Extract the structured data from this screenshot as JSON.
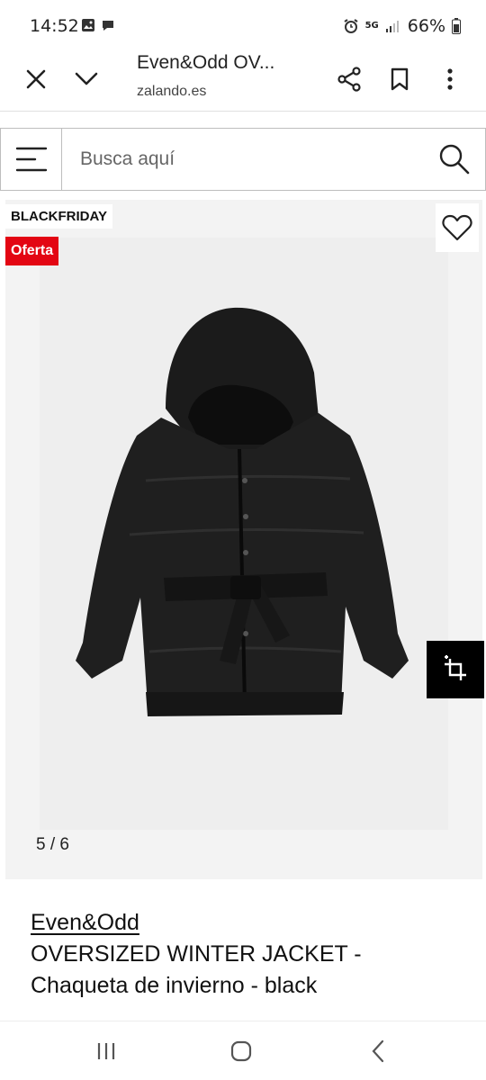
{
  "status": {
    "time": "14:52",
    "network": "5G",
    "battery": "66%"
  },
  "browser": {
    "title": "Even&Odd OV...",
    "url": "zalando.es",
    "icons": [
      "close-icon",
      "chevron-down-icon",
      "share-icon",
      "bookmark-icon",
      "more-vert-icon"
    ]
  },
  "search": {
    "placeholder": "Busca aquí"
  },
  "gallery": {
    "badge_primary": "BLACKFRIDAY",
    "badge_offer": "Oferta",
    "counter": "5 / 6",
    "colors": {
      "offer": "#e30613",
      "background": "#f3f3f3"
    }
  },
  "product": {
    "brand": "Even&Odd",
    "name_line1": "OVERSIZED WINTER JACKET -",
    "name_line2": "Chaqueta de invierno - black"
  },
  "navbar": {
    "icons": [
      "recent-apps-icon",
      "home-icon",
      "back-icon"
    ]
  }
}
